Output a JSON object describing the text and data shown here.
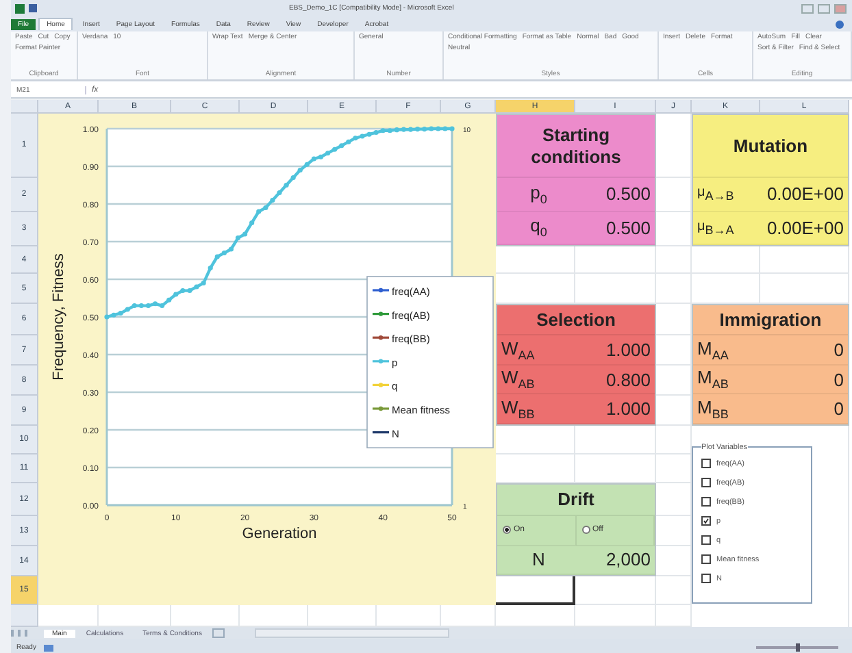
{
  "window": {
    "title": "EBS_Demo_1C [Compatibility Mode] - Microsoft Excel"
  },
  "ribbon": {
    "tabs": [
      {
        "label": "File",
        "selected": false
      },
      {
        "label": "Home",
        "selected": true
      },
      {
        "label": "Insert",
        "selected": false
      },
      {
        "label": "Page Layout",
        "selected": false
      },
      {
        "label": "Formulas",
        "selected": false
      },
      {
        "label": "Data",
        "selected": false
      },
      {
        "label": "Review",
        "selected": false
      },
      {
        "label": "View",
        "selected": false
      },
      {
        "label": "Developer",
        "selected": false
      },
      {
        "label": "Acrobat",
        "selected": false
      }
    ],
    "groups": [
      {
        "label": "Clipboard",
        "items": [
          "Paste",
          "Cut",
          "Copy",
          "Format Painter"
        ]
      },
      {
        "label": "Font",
        "items": [
          "Verdana",
          "10"
        ]
      },
      {
        "label": "Alignment",
        "items": [
          "Wrap Text",
          "Merge & Center"
        ]
      },
      {
        "label": "Number",
        "items": [
          "General"
        ]
      },
      {
        "label": "Styles",
        "items": [
          "Conditional Formatting",
          "Format as Table",
          "Normal",
          "Bad",
          "Good",
          "Neutral"
        ]
      },
      {
        "label": "Cells",
        "items": [
          "Insert",
          "Delete",
          "Format"
        ]
      },
      {
        "label": "Editing",
        "items": [
          "AutoSum",
          "Fill",
          "Clear",
          "Sort & Filter",
          "Find & Select"
        ]
      }
    ]
  },
  "formula_bar": {
    "name_box": "M21",
    "fx": "fx"
  },
  "sheet": {
    "columns": [
      {
        "label": "A",
        "selected": false
      },
      {
        "label": "B",
        "selected": false
      },
      {
        "label": "C",
        "selected": false
      },
      {
        "label": "D",
        "selected": false
      },
      {
        "label": "E",
        "selected": false
      },
      {
        "label": "F",
        "selected": false
      },
      {
        "label": "G",
        "selected": false
      },
      {
        "label": "H",
        "selected": true
      },
      {
        "label": "I",
        "selected": false
      },
      {
        "label": "J",
        "selected": false
      },
      {
        "label": "K",
        "selected": false
      },
      {
        "label": "L",
        "selected": false
      }
    ],
    "rows": [
      {
        "label": "1",
        "selected": false
      },
      {
        "label": "2",
        "selected": false
      },
      {
        "label": "3",
        "selected": false
      },
      {
        "label": "4",
        "selected": false
      },
      {
        "label": "5",
        "selected": false
      },
      {
        "label": "6",
        "selected": false
      },
      {
        "label": "7",
        "selected": false
      },
      {
        "label": "8",
        "selected": false
      },
      {
        "label": "9",
        "selected": false
      },
      {
        "label": "10",
        "selected": false
      },
      {
        "label": "11",
        "selected": false
      },
      {
        "label": "12",
        "selected": false
      },
      {
        "label": "13",
        "selected": false
      },
      {
        "label": "14",
        "selected": false
      },
      {
        "label": "15",
        "selected": true
      }
    ]
  },
  "chart": {
    "chart_data": {
      "type": "line",
      "xlabel": "Generation",
      "ylabel": "Frequency, Fitness",
      "grid": true,
      "x": [
        0,
        1,
        2,
        3,
        4,
        5,
        6,
        7,
        8,
        9,
        10,
        11,
        12,
        13,
        14,
        15,
        16,
        17,
        18,
        19,
        20,
        21,
        22,
        23,
        24,
        25,
        26,
        27,
        28,
        29,
        30,
        31,
        32,
        33,
        34,
        35,
        36,
        37,
        38,
        39,
        40,
        41,
        42,
        43,
        44,
        45,
        46,
        47,
        48,
        49,
        50
      ],
      "series": [
        {
          "name": "freq(AA)",
          "color": "#2f5fd0",
          "marker": "circle",
          "values": [
            null,
            null,
            null,
            null,
            null,
            null,
            null,
            null,
            null,
            null,
            null,
            null,
            null,
            null,
            null,
            null,
            null,
            null,
            null,
            null,
            null,
            null,
            null,
            null,
            null,
            null,
            null,
            null,
            null,
            null,
            null,
            null,
            null,
            null,
            null,
            null,
            null,
            null,
            null,
            null,
            null,
            null,
            null,
            null,
            null,
            null,
            null,
            null,
            null,
            null,
            null
          ]
        },
        {
          "name": "freq(AB)",
          "color": "#2e9a3a",
          "marker": "circle",
          "values": [
            null,
            null,
            null,
            null,
            null,
            null,
            null,
            null,
            null,
            null,
            null,
            null,
            null,
            null,
            null,
            null,
            null,
            null,
            null,
            null,
            null,
            null,
            null,
            null,
            null,
            null,
            null,
            null,
            null,
            null,
            null,
            null,
            null,
            null,
            null,
            null,
            null,
            null,
            null,
            null,
            null,
            null,
            null,
            null,
            null,
            null,
            null,
            null,
            null,
            null,
            null
          ]
        },
        {
          "name": "freq(BB)",
          "color": "#a04a3a",
          "marker": "circle",
          "values": [
            null,
            null,
            null,
            null,
            null,
            null,
            null,
            null,
            null,
            null,
            null,
            null,
            null,
            null,
            null,
            null,
            null,
            null,
            null,
            null,
            null,
            null,
            null,
            null,
            null,
            null,
            null,
            null,
            null,
            null,
            null,
            null,
            null,
            null,
            null,
            null,
            null,
            null,
            null,
            null,
            null,
            null,
            null,
            null,
            null,
            null,
            null,
            null,
            null,
            null,
            null
          ]
        },
        {
          "name": "p",
          "color": "#4fc3dc",
          "marker": "circle",
          "values": [
            0.5,
            0.505,
            0.51,
            0.52,
            0.53,
            0.53,
            0.53,
            0.535,
            0.53,
            0.545,
            0.56,
            0.57,
            0.57,
            0.58,
            0.59,
            0.63,
            0.66,
            0.67,
            0.68,
            0.71,
            0.72,
            0.75,
            0.78,
            0.79,
            0.81,
            0.83,
            0.85,
            0.87,
            0.89,
            0.905,
            0.92,
            0.925,
            0.935,
            0.945,
            0.955,
            0.965,
            0.975,
            0.98,
            0.985,
            0.99,
            0.995,
            0.995,
            0.997,
            0.998,
            0.998,
            0.999,
            0.999,
            1,
            1,
            1,
            1
          ]
        },
        {
          "name": "q",
          "color": "#f2d23a",
          "marker": "circle",
          "values": [
            null,
            null,
            null,
            null,
            null,
            null,
            null,
            null,
            null,
            null,
            null,
            null,
            null,
            null,
            null,
            null,
            null,
            null,
            null,
            null,
            null,
            null,
            null,
            null,
            null,
            null,
            null,
            null,
            null,
            null,
            null,
            null,
            null,
            null,
            null,
            null,
            null,
            null,
            null,
            null,
            null,
            null,
            null,
            null,
            null,
            null,
            null,
            null,
            null,
            null,
            null
          ]
        },
        {
          "name": "Mean fitness",
          "color": "#7a9a3a",
          "marker": "circle",
          "values": [
            null,
            null,
            null,
            null,
            null,
            null,
            null,
            null,
            null,
            null,
            null,
            null,
            null,
            null,
            null,
            null,
            null,
            null,
            null,
            null,
            null,
            null,
            null,
            null,
            null,
            null,
            null,
            null,
            null,
            null,
            null,
            null,
            null,
            null,
            null,
            null,
            null,
            null,
            null,
            null,
            null,
            null,
            null,
            null,
            null,
            null,
            null,
            null,
            null,
            null,
            null
          ]
        },
        {
          "name": "N",
          "color": "#1f3a6a",
          "values": [
            null,
            null,
            null,
            null,
            null,
            null,
            null,
            null,
            null,
            null,
            null,
            null,
            null,
            null,
            null,
            null,
            null,
            null,
            null,
            null,
            null,
            null,
            null,
            null,
            null,
            null,
            null,
            null,
            null,
            null,
            null,
            null,
            null,
            null,
            null,
            null,
            null,
            null,
            null,
            null,
            null,
            null,
            null,
            null,
            null,
            null,
            null,
            null,
            null,
            null,
            null
          ]
        }
      ],
      "xlim": [
        0,
        50
      ],
      "ylim": [
        0,
        1
      ],
      "xticks": [
        0,
        10,
        20,
        30,
        40,
        50
      ],
      "yticks": [
        {
          "value": 0,
          "label": "0.00"
        },
        {
          "value": 0.1,
          "label": "0.10"
        },
        {
          "value": 0.2,
          "label": "0.20"
        },
        {
          "value": 0.3,
          "label": "0.30"
        },
        {
          "value": 0.4,
          "label": "0.40"
        },
        {
          "value": 0.5,
          "label": "0.50"
        },
        {
          "value": 0.6,
          "label": "0.60"
        },
        {
          "value": 0.7,
          "label": "0.70"
        },
        {
          "value": 0.8,
          "label": "0.80"
        },
        {
          "value": 0.9,
          "label": "0.90"
        },
        {
          "value": 1,
          "label": "1.00"
        }
      ],
      "y2lim": [
        1,
        10
      ],
      "y2ticks": [
        {
          "value": 1,
          "label": "1"
        },
        {
          "value": 10,
          "label": "10"
        }
      ]
    }
  },
  "panels": [
    {
      "kind": "parameters",
      "title": "Starting conditions",
      "color": "#ec8bcb",
      "rows": [
        {
          "label": "p$_{0}$",
          "value": "0.500"
        },
        {
          "label": "q$_{0}$",
          "value": "0.500"
        }
      ]
    },
    {
      "kind": "parameters",
      "title": "Mutation",
      "color": "#f6ee80",
      "rows": [
        {
          "label": "μ$_{A→B}$",
          "value": "0.00E+00"
        },
        {
          "label": "μ$_{B→A}$",
          "value": "0.00E+00"
        }
      ]
    },
    {
      "kind": "parameters",
      "title": "Selection",
      "color": "#ec6f6f",
      "rows": [
        {
          "label": "W$_{AA}$",
          "value": "1.000"
        },
        {
          "label": "W$_{AB}$",
          "value": "0.800"
        },
        {
          "label": "W$_{BB}$",
          "value": "1.000"
        }
      ]
    },
    {
      "kind": "parameters",
      "title": "Immigration",
      "color": "#f9bb8c",
      "rows": [
        {
          "label": "M$_{AA}$",
          "value": "0"
        },
        {
          "label": "M$_{AB}$",
          "value": "0"
        },
        {
          "label": "M$_{BB}$",
          "value": "0"
        }
      ]
    },
    {
      "kind": "drift",
      "title": "Drift",
      "color": "#c3e2b3",
      "options": [
        {
          "label": "On",
          "selected": true
        },
        {
          "label": "Off",
          "selected": false
        }
      ],
      "rows": [
        {
          "label": "N",
          "value": "2,000"
        }
      ]
    }
  ],
  "plot_variables": {
    "title": "Plot Variables",
    "items": [
      {
        "label": "freq(AA)",
        "checked": false
      },
      {
        "label": "freq(AB)",
        "checked": false
      },
      {
        "label": "freq(BB)",
        "checked": false
      },
      {
        "label": "p",
        "checked": true
      },
      {
        "label": "q",
        "checked": false
      },
      {
        "label": "Mean fitness",
        "checked": false
      },
      {
        "label": "N",
        "checked": false
      }
    ]
  },
  "sheet_tabs": [
    {
      "label": "Main",
      "selected": true
    },
    {
      "label": "Calculations",
      "selected": false
    },
    {
      "label": "Terms & Conditions",
      "selected": false
    }
  ],
  "status_bar": {
    "text": "Ready",
    "zoom": {
      "level": 0.5
    }
  }
}
